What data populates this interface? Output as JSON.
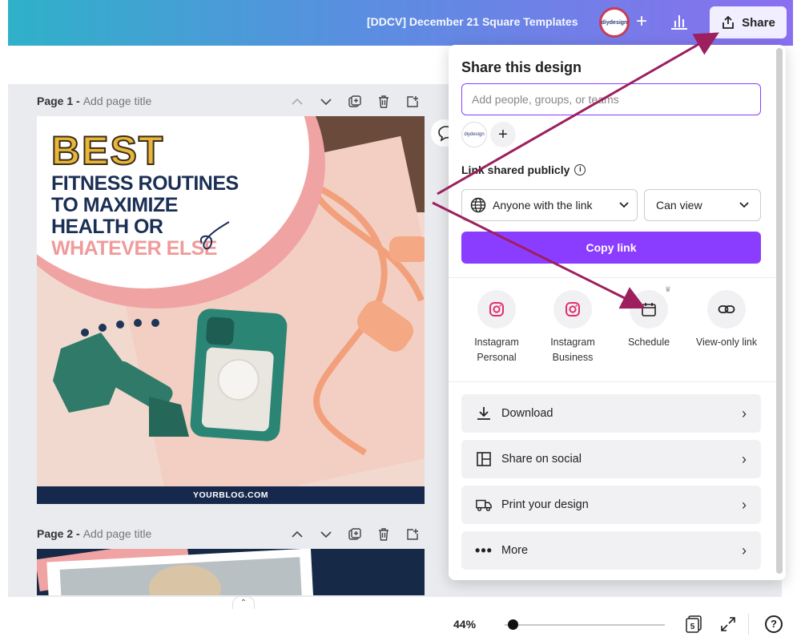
{
  "header": {
    "doc_title": "[DDCV] December 21 Square Templates",
    "brand_avatar": "diydesign",
    "share_label": "Share"
  },
  "pages": [
    {
      "label": "Page 1 -",
      "title_placeholder": "Add page title",
      "design": {
        "headline_1": "BEST",
        "lines": [
          "FITNESS ROUTINES",
          "TO MAXIMIZE",
          "HEALTH OR"
        ],
        "pink_line": "WHATEVER ELSE",
        "footer": "YOURBLOG.COM"
      }
    },
    {
      "label": "Page 2 -",
      "title_placeholder": "Add page title"
    }
  ],
  "share_panel": {
    "title": "Share this design",
    "people_placeholder": "Add people, groups, or teams",
    "member_avatar": "diydesign",
    "link_label": "Link shared publicly",
    "access_value": "Anyone with the link",
    "permission_value": "Can view",
    "copy_link_label": "Copy link",
    "options": [
      {
        "label_line1": "Instagram",
        "label_line2": "Personal",
        "icon": "instagram-icon"
      },
      {
        "label_line1": "Instagram",
        "label_line2": "Business",
        "icon": "instagram-icon"
      },
      {
        "label_line1": "Schedule",
        "label_line2": "",
        "icon": "calendar-icon"
      },
      {
        "label_line1": "View-only link",
        "label_line2": "",
        "icon": "link-icon"
      }
    ],
    "actions": [
      {
        "label": "Download",
        "icon": "download-icon"
      },
      {
        "label": "Share on social",
        "icon": "layout-icon"
      },
      {
        "label": "Print your design",
        "icon": "truck-icon"
      },
      {
        "label": "More",
        "icon": "ellipsis-icon"
      }
    ]
  },
  "footer": {
    "zoom": "44%",
    "zoom_value": 0.05,
    "page_count": "5",
    "help": "?"
  },
  "colors": {
    "accent": "#8b3dff",
    "arrow": "#9c1f5e",
    "instagram": "#e1306c"
  }
}
